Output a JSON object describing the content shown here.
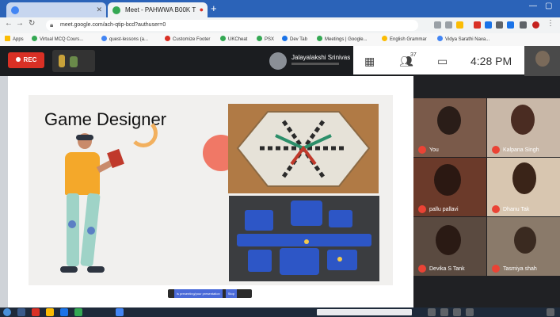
{
  "browser": {
    "tabs": [
      {
        "title": ""
      },
      {
        "title": "Meet - PAHWWA B00K T"
      }
    ],
    "new_tab": "+",
    "url": "meet.google.com/ach-qtip-bcd?authuser=0",
    "bookmarks": [
      "Apps",
      "Virtual MCQ Cours...",
      "quest-lessons (a...",
      "Customize Footer",
      "UKCheat",
      "PSX",
      "Dev Tab",
      "Meetings | Google...",
      "English Grammar",
      "Vidya Sarathi Nava..."
    ]
  },
  "meet": {
    "rec_label": "REC",
    "presenter_name": "Jalayalakshi Srinivas",
    "participant_count": "37",
    "time": "4:28 PM",
    "slide": {
      "title": "Game Designer",
      "caption_text": "is presenting/your presentation",
      "caption_button": "Stop"
    },
    "participants": [
      {
        "name": "You"
      },
      {
        "name": "Kalpana Singh"
      },
      {
        "name": "pallu pallavi"
      },
      {
        "name": "Dhanu Tak"
      },
      {
        "name": "Devika S Tank"
      },
      {
        "name": "Tasmiya shah"
      }
    ]
  },
  "colors": {
    "rec": "#d93025",
    "mic_muted": "#ea4335",
    "tabbar": "#2b63b8"
  }
}
